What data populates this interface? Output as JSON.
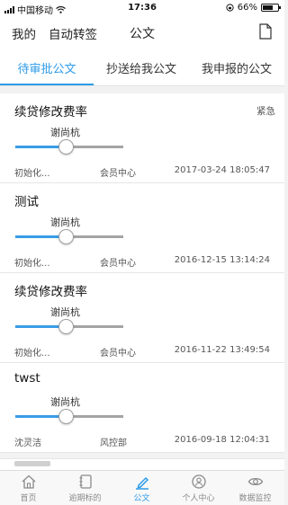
{
  "status_bar": {
    "carrier": "中国移动",
    "time": "17:36",
    "battery": "66%",
    "battery_level": 0.66
  },
  "header": {
    "left_links": [
      "我的",
      "自动转签"
    ],
    "title": "公文"
  },
  "tabs": [
    {
      "label": "待审批公文",
      "active": true
    },
    {
      "label": "抄送给我公文",
      "active": false
    },
    {
      "label": "我申报的公文",
      "active": false
    }
  ],
  "items": [
    {
      "title": "续贷修改费率",
      "tag": "紧急",
      "approver": "谢尚杭",
      "initiator": "初始化...",
      "department": "会员中心",
      "time": "2017-03-24 18:05:47"
    },
    {
      "title": "测试",
      "tag": "",
      "approver": "谢尚杭",
      "initiator": "初始化...",
      "department": "会员中心",
      "time": "2016-12-15 13:14:24"
    },
    {
      "title": "续贷修改费率",
      "tag": "",
      "approver": "谢尚杭",
      "initiator": "初始化...",
      "department": "会员中心",
      "time": "2016-11-22 13:49:54"
    },
    {
      "title": "twst",
      "tag": "",
      "approver": "谢尚杭",
      "initiator": "沈灵洁",
      "department": "风控部",
      "time": "2016-09-18 12:04:31"
    }
  ],
  "tabbar": [
    {
      "label": "首页",
      "icon": "home-icon",
      "active": false
    },
    {
      "label": "逾期标的",
      "icon": "notebook-icon",
      "active": false
    },
    {
      "label": "公文",
      "icon": "pen-icon",
      "active": true
    },
    {
      "label": "个人中心",
      "icon": "person-icon",
      "active": false
    },
    {
      "label": "数据监控",
      "icon": "eye-icon",
      "active": false
    }
  ],
  "colors": {
    "accent": "#2d9be8",
    "track_done": "#3a9de6",
    "track_todo": "#a4a4a4"
  }
}
